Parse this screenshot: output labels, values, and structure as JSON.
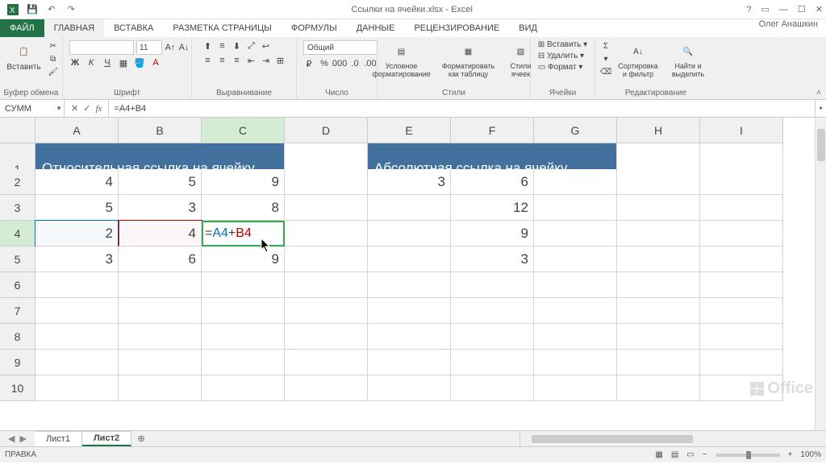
{
  "window": {
    "title": "Ссылки на ячейки.xlsx - Excel"
  },
  "user": "Олег Анашкин",
  "tabs": [
    "ФАЙЛ",
    "ГЛАВНАЯ",
    "ВСТАВКА",
    "РАЗМЕТКА СТРАНИЦЫ",
    "ФОРМУЛЫ",
    "ДАННЫЕ",
    "РЕЦЕНЗИРОВАНИЕ",
    "ВИД"
  ],
  "ribbon": {
    "clipboard": {
      "paste": "Вставить",
      "label": "Буфер обмена"
    },
    "font": {
      "size": "11",
      "label": "Шрифт"
    },
    "align": {
      "label": "Выравнивание"
    },
    "number": {
      "format": "Общий",
      "label": "Число"
    },
    "styles": {
      "cond": "Условное форматирование",
      "table": "Форматировать как таблицу",
      "cell": "Стили ячеек",
      "label": "Стили"
    },
    "cells": {
      "insert": "Вставить",
      "delete": "Удалить",
      "format": "Формат",
      "label": "Ячейки"
    },
    "editing": {
      "sort": "Сортировка и фильтр",
      "find": "Найти и выделить",
      "label": "Редактирование"
    }
  },
  "formula_bar": {
    "namebox": "СУММ",
    "formula": "=A4+B4"
  },
  "columns": [
    "A",
    "B",
    "C",
    "D",
    "E",
    "F",
    "G",
    "H",
    "I"
  ],
  "rows": [
    "1",
    "2",
    "3",
    "4",
    "5",
    "6",
    "7",
    "8",
    "9",
    "10"
  ],
  "sheet": {
    "header_left": "Относительная ссылка на ячейку",
    "header_right": "Абсолютная ссылка на ячейку",
    "data": {
      "A2": "4",
      "B2": "5",
      "C2": "9",
      "E2": "3",
      "F2": "6",
      "A3": "5",
      "B3": "3",
      "C3": "8",
      "F3": "12",
      "A4": "2",
      "B4": "4",
      "F4": "9",
      "A5": "3",
      "B5": "6",
      "C5": "9",
      "F5": "3"
    },
    "editing_cell": {
      "eq": "=",
      "ref1": "A4",
      "plus": "+",
      "ref2": "B4"
    }
  },
  "sheet_tabs": [
    "Лист1",
    "Лист2"
  ],
  "status": {
    "mode": "ПРАВКА",
    "zoom": "100%"
  },
  "brand": "Office"
}
